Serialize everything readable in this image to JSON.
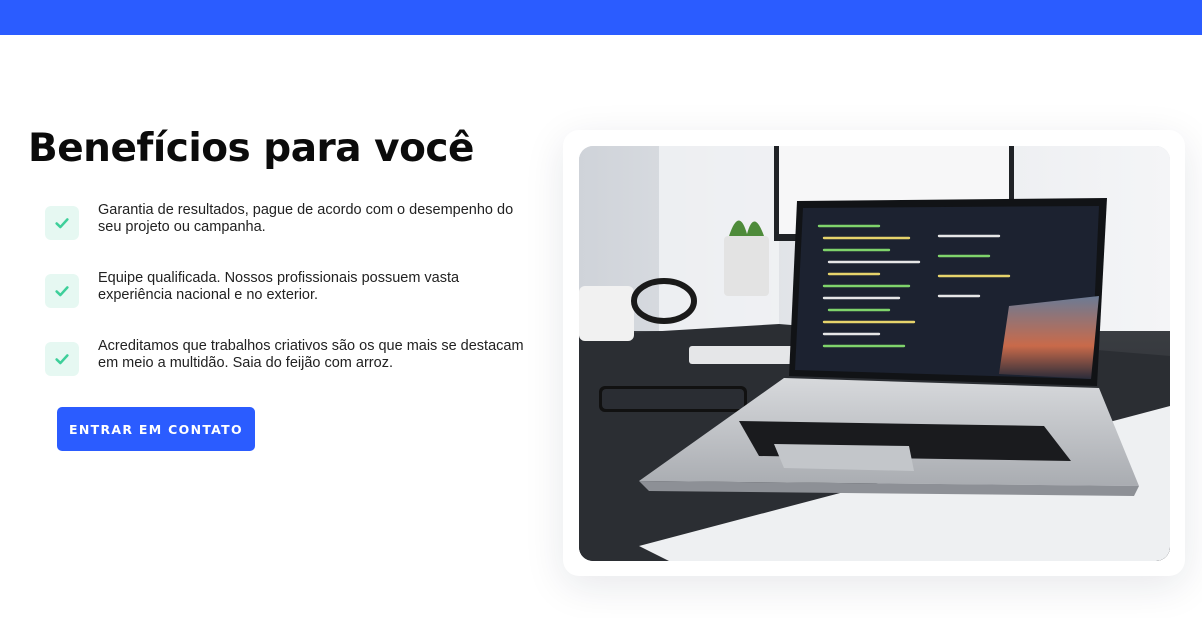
{
  "header": {
    "accent_color": "#2b5cff"
  },
  "section": {
    "title": "Benefícios para você",
    "benefits": [
      {
        "icon": "check-icon",
        "text": "Garantia de resultados, pague de acordo com o desempenho do seu projeto ou campanha."
      },
      {
        "icon": "check-icon",
        "text": "Equipe qualificada. Nossos profissionais possuem vasta experiência nacional e no exterior."
      },
      {
        "icon": "check-icon",
        "text": "Acreditamos que trabalhos criativos são os que mais se destacam em meio a multidão. Saia do feijão com arroz."
      }
    ],
    "cta_label": "ENTRAR EM CONTATO"
  },
  "colors": {
    "primary": "#2b5cff",
    "check": "#3ecf9a",
    "check_bg": "#e6f8f2"
  },
  "image": {
    "subject": "laptop-with-code-photo"
  }
}
